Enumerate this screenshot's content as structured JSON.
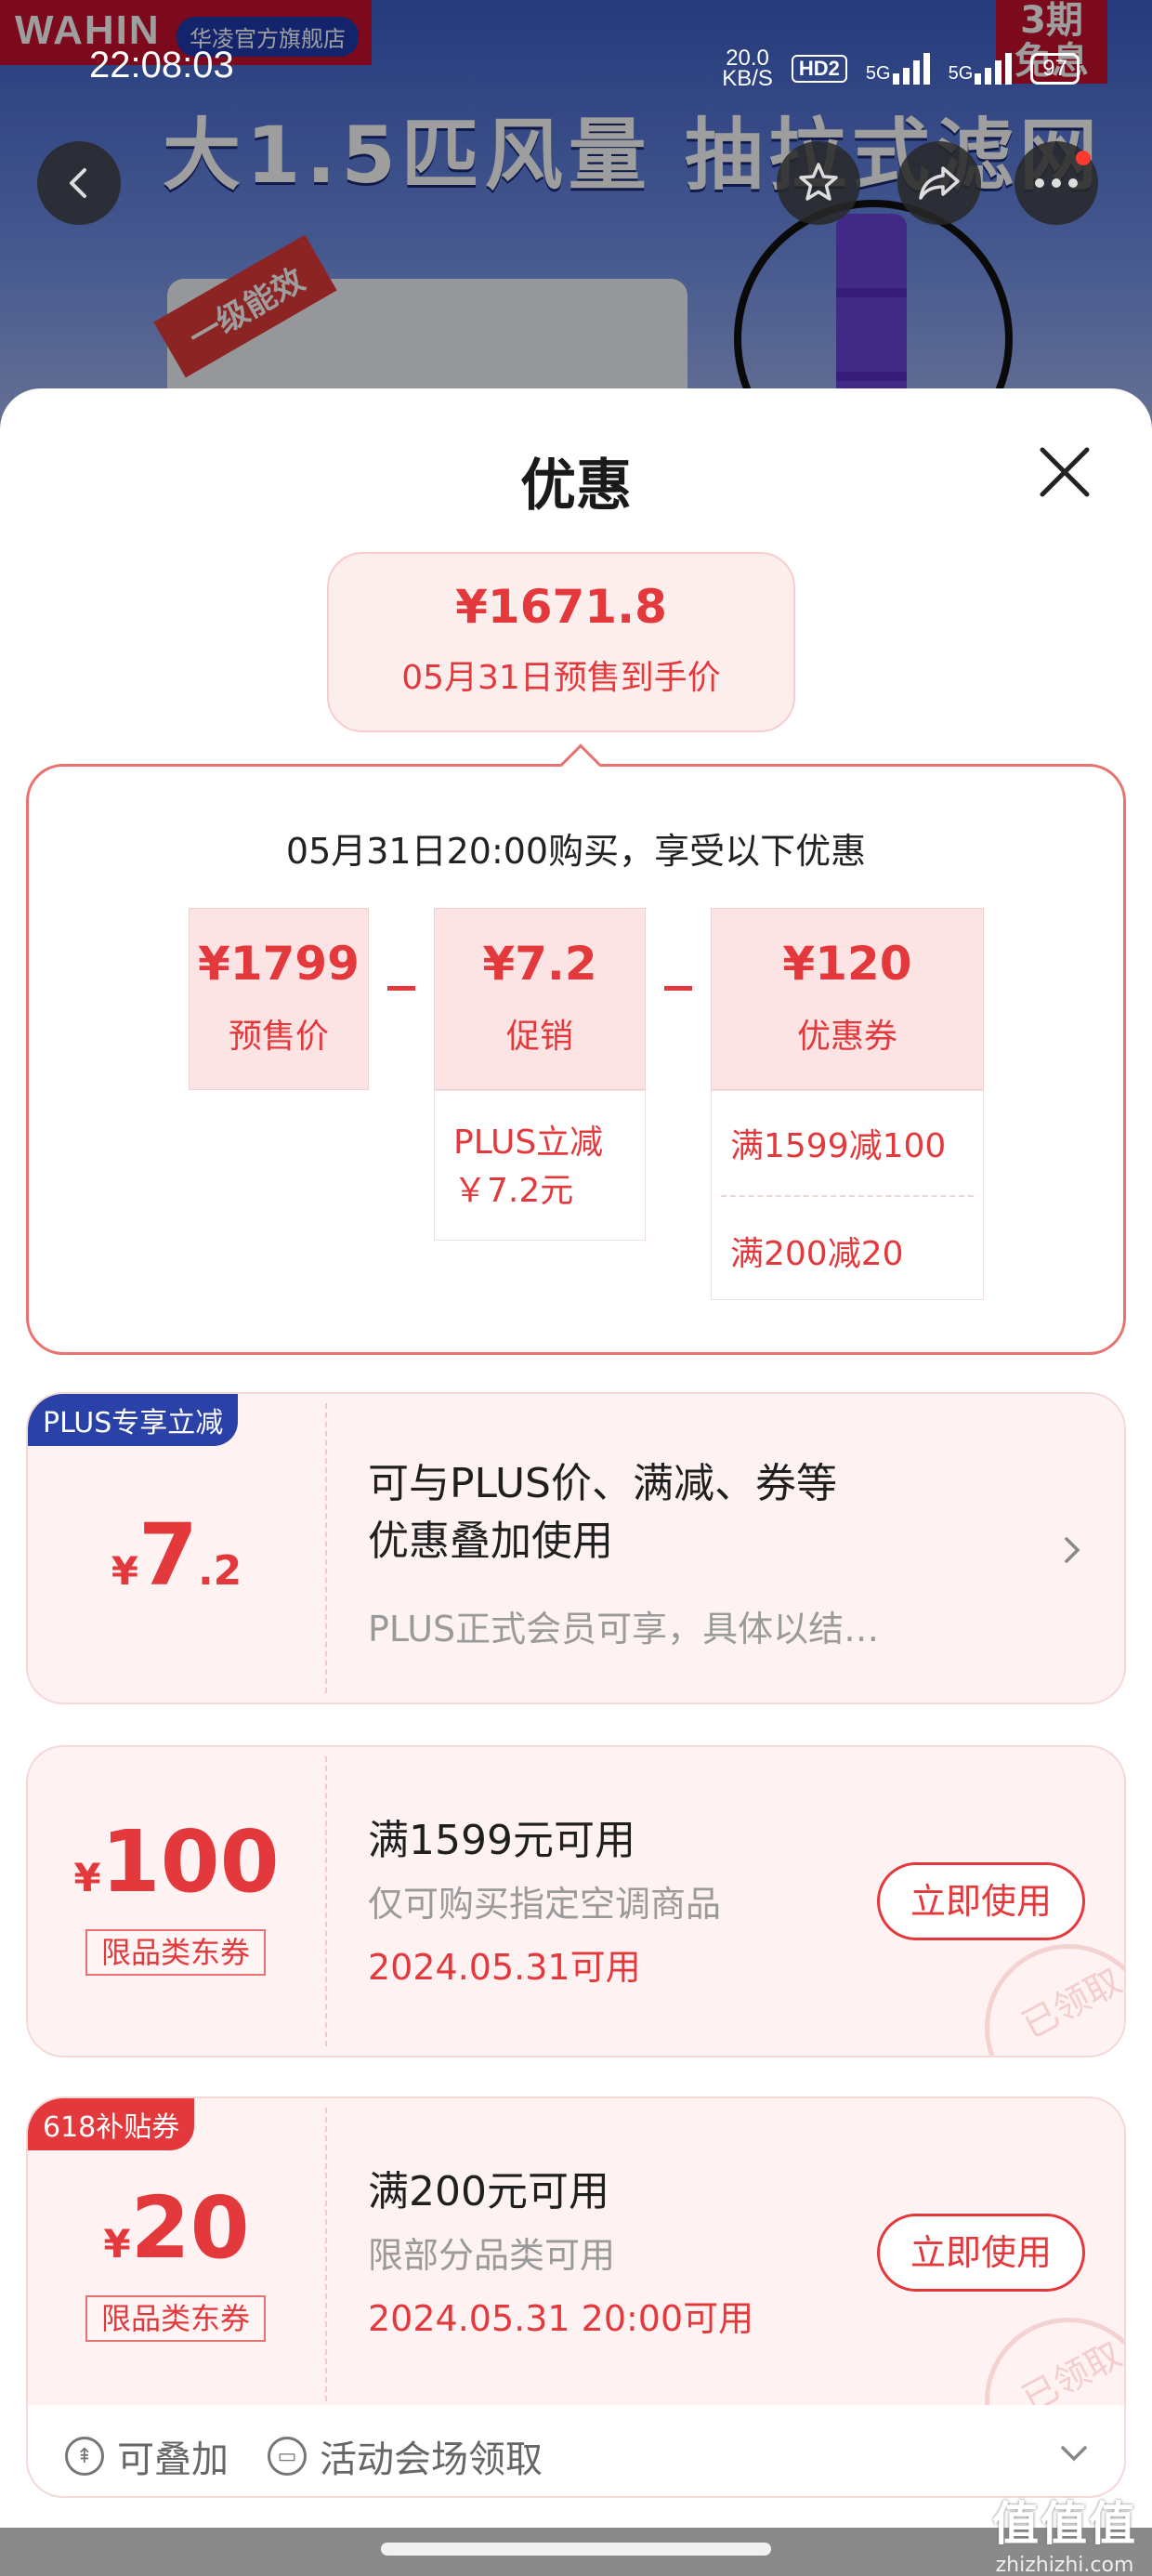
{
  "background": {
    "brand_logo": "WAHIN",
    "store_name": "华凌官方旗舰店",
    "promo_tag": "3期\n免息",
    "banner_text": "大1.5匹风量 抽拉式滤网",
    "energy_badge": "一级能效"
  },
  "status_bar": {
    "time": "22:08:03",
    "net_rate": "20.0",
    "net_unit": "KB/S",
    "hd": "HD2",
    "signal_1": "5G",
    "signal_2": "5G",
    "battery": "97"
  },
  "sheet": {
    "title": "优惠",
    "final_price": "¥1671.8",
    "final_price_label": "05月31日预售到手价",
    "breakdown": {
      "heading": "05月31日20:00购买，享受以下优惠",
      "items": [
        {
          "value": "¥1799",
          "label": "预售价"
        },
        {
          "value": "¥7.2",
          "label": "促销"
        },
        {
          "value": "¥120",
          "label": "优惠券"
        }
      ],
      "promo_detail_1": "PLUS立减",
      "promo_detail_2": "￥7.2元",
      "coupon_detail_1": "满1599减100",
      "coupon_detail_2": "满200减20"
    },
    "plus_card": {
      "tag": "PLUS专享立减",
      "currency": "¥",
      "amount_int": "7",
      "amount_dec": ".2",
      "title_line1": "可与PLUS价、满减、券等",
      "title_line2": "优惠叠加使用",
      "subtitle": "PLUS正式会员可享，具体以结…"
    },
    "coupon_100": {
      "currency": "¥",
      "amount": "100",
      "badge": "限品类东券",
      "title": "满1599元可用",
      "subtitle": "仅可购买指定空调商品",
      "date": "2024.05.31可用",
      "button": "立即使用",
      "stamp": "已领取"
    },
    "coupon_20": {
      "tag": "618补贴券",
      "currency": "¥",
      "amount": "20",
      "badge": "限品类东券",
      "title": "满200元可用",
      "subtitle": "限部分品类可用",
      "date": "2024.05.31 20:00可用",
      "button": "立即使用",
      "stamp": "已领取"
    },
    "footer": {
      "stackable": "可叠加",
      "venue": "活动会场领取"
    }
  },
  "watermark": {
    "main": "值值值",
    "sub": "zhizhizhi.com"
  },
  "colors": {
    "accent": "#e4393c",
    "plus_tag": "#2a41a8",
    "subsidy_tag": "#e4393c"
  }
}
